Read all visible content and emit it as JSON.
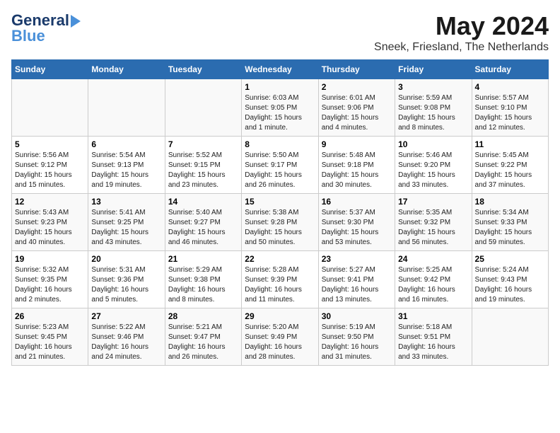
{
  "header": {
    "logo_general": "General",
    "logo_blue": "Blue",
    "month_title": "May 2024",
    "location": "Sneek, Friesland, The Netherlands"
  },
  "days_of_week": [
    "Sunday",
    "Monday",
    "Tuesday",
    "Wednesday",
    "Thursday",
    "Friday",
    "Saturday"
  ],
  "weeks": [
    [
      {
        "day": "",
        "info": ""
      },
      {
        "day": "",
        "info": ""
      },
      {
        "day": "",
        "info": ""
      },
      {
        "day": "1",
        "info": "Sunrise: 6:03 AM\nSunset: 9:05 PM\nDaylight: 15 hours\nand 1 minute."
      },
      {
        "day": "2",
        "info": "Sunrise: 6:01 AM\nSunset: 9:06 PM\nDaylight: 15 hours\nand 4 minutes."
      },
      {
        "day": "3",
        "info": "Sunrise: 5:59 AM\nSunset: 9:08 PM\nDaylight: 15 hours\nand 8 minutes."
      },
      {
        "day": "4",
        "info": "Sunrise: 5:57 AM\nSunset: 9:10 PM\nDaylight: 15 hours\nand 12 minutes."
      }
    ],
    [
      {
        "day": "5",
        "info": "Sunrise: 5:56 AM\nSunset: 9:12 PM\nDaylight: 15 hours\nand 15 minutes."
      },
      {
        "day": "6",
        "info": "Sunrise: 5:54 AM\nSunset: 9:13 PM\nDaylight: 15 hours\nand 19 minutes."
      },
      {
        "day": "7",
        "info": "Sunrise: 5:52 AM\nSunset: 9:15 PM\nDaylight: 15 hours\nand 23 minutes."
      },
      {
        "day": "8",
        "info": "Sunrise: 5:50 AM\nSunset: 9:17 PM\nDaylight: 15 hours\nand 26 minutes."
      },
      {
        "day": "9",
        "info": "Sunrise: 5:48 AM\nSunset: 9:18 PM\nDaylight: 15 hours\nand 30 minutes."
      },
      {
        "day": "10",
        "info": "Sunrise: 5:46 AM\nSunset: 9:20 PM\nDaylight: 15 hours\nand 33 minutes."
      },
      {
        "day": "11",
        "info": "Sunrise: 5:45 AM\nSunset: 9:22 PM\nDaylight: 15 hours\nand 37 minutes."
      }
    ],
    [
      {
        "day": "12",
        "info": "Sunrise: 5:43 AM\nSunset: 9:23 PM\nDaylight: 15 hours\nand 40 minutes."
      },
      {
        "day": "13",
        "info": "Sunrise: 5:41 AM\nSunset: 9:25 PM\nDaylight: 15 hours\nand 43 minutes."
      },
      {
        "day": "14",
        "info": "Sunrise: 5:40 AM\nSunset: 9:27 PM\nDaylight: 15 hours\nand 46 minutes."
      },
      {
        "day": "15",
        "info": "Sunrise: 5:38 AM\nSunset: 9:28 PM\nDaylight: 15 hours\nand 50 minutes."
      },
      {
        "day": "16",
        "info": "Sunrise: 5:37 AM\nSunset: 9:30 PM\nDaylight: 15 hours\nand 53 minutes."
      },
      {
        "day": "17",
        "info": "Sunrise: 5:35 AM\nSunset: 9:32 PM\nDaylight: 15 hours\nand 56 minutes."
      },
      {
        "day": "18",
        "info": "Sunrise: 5:34 AM\nSunset: 9:33 PM\nDaylight: 15 hours\nand 59 minutes."
      }
    ],
    [
      {
        "day": "19",
        "info": "Sunrise: 5:32 AM\nSunset: 9:35 PM\nDaylight: 16 hours\nand 2 minutes."
      },
      {
        "day": "20",
        "info": "Sunrise: 5:31 AM\nSunset: 9:36 PM\nDaylight: 16 hours\nand 5 minutes."
      },
      {
        "day": "21",
        "info": "Sunrise: 5:29 AM\nSunset: 9:38 PM\nDaylight: 16 hours\nand 8 minutes."
      },
      {
        "day": "22",
        "info": "Sunrise: 5:28 AM\nSunset: 9:39 PM\nDaylight: 16 hours\nand 11 minutes."
      },
      {
        "day": "23",
        "info": "Sunrise: 5:27 AM\nSunset: 9:41 PM\nDaylight: 16 hours\nand 13 minutes."
      },
      {
        "day": "24",
        "info": "Sunrise: 5:25 AM\nSunset: 9:42 PM\nDaylight: 16 hours\nand 16 minutes."
      },
      {
        "day": "25",
        "info": "Sunrise: 5:24 AM\nSunset: 9:43 PM\nDaylight: 16 hours\nand 19 minutes."
      }
    ],
    [
      {
        "day": "26",
        "info": "Sunrise: 5:23 AM\nSunset: 9:45 PM\nDaylight: 16 hours\nand 21 minutes."
      },
      {
        "day": "27",
        "info": "Sunrise: 5:22 AM\nSunset: 9:46 PM\nDaylight: 16 hours\nand 24 minutes."
      },
      {
        "day": "28",
        "info": "Sunrise: 5:21 AM\nSunset: 9:47 PM\nDaylight: 16 hours\nand 26 minutes."
      },
      {
        "day": "29",
        "info": "Sunrise: 5:20 AM\nSunset: 9:49 PM\nDaylight: 16 hours\nand 28 minutes."
      },
      {
        "day": "30",
        "info": "Sunrise: 5:19 AM\nSunset: 9:50 PM\nDaylight: 16 hours\nand 31 minutes."
      },
      {
        "day": "31",
        "info": "Sunrise: 5:18 AM\nSunset: 9:51 PM\nDaylight: 16 hours\nand 33 minutes."
      },
      {
        "day": "",
        "info": ""
      }
    ]
  ]
}
